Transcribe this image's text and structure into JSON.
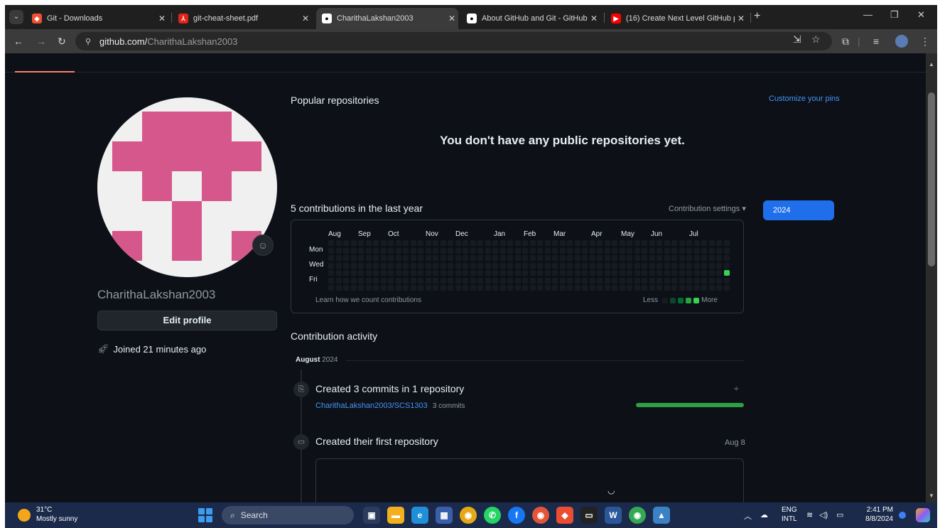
{
  "browser": {
    "tabs": [
      {
        "title": "Git - Downloads",
        "favicon": "git-icon",
        "color": "#f05133"
      },
      {
        "title": "git-cheat-sheet.pdf",
        "favicon": "pdf-icon",
        "color": "#e2231a"
      },
      {
        "title": "CharithaLakshan2003",
        "favicon": "github-icon",
        "color": "#ffffff"
      },
      {
        "title": "About GitHub and Git - GitHub",
        "favicon": "github-icon",
        "color": "#ffffff"
      },
      {
        "title": "(16) Create Next Level GitHub p",
        "favicon": "youtube-icon",
        "color": "#ff0000"
      }
    ],
    "active_tab_index": 2,
    "url_host": "github.com/",
    "url_path": "CharithaLakshan2003"
  },
  "profile": {
    "username": "CharithaLakshan2003",
    "edit_label": "Edit profile",
    "joined": "Joined 21 minutes ago",
    "avatar_color": "#d6578b"
  },
  "popular": {
    "title": "Popular repositories",
    "customize": "Customize your pins",
    "empty_message": "You don't have any public repositories yet."
  },
  "contributions": {
    "title": "5 contributions in the last year",
    "settings_label": "Contribution settings",
    "year": "2024",
    "months": [
      "Aug",
      "Sep",
      "Oct",
      "Nov",
      "Dec",
      "Jan",
      "Feb",
      "Mar",
      "Apr",
      "May",
      "Jun",
      "Jul"
    ],
    "day_labels": [
      "Mon",
      "Wed",
      "Fri"
    ],
    "learn": "Learn how we count contributions",
    "legend_less": "Less",
    "legend_more": "More",
    "active_cell": {
      "week": 53,
      "day": 4
    }
  },
  "activity": {
    "title": "Contribution activity",
    "month": "August",
    "year": "2024",
    "events": [
      {
        "title": "Created 3 commits in 1 repository",
        "repo": "CharithaLakshan2003/SCS1303",
        "commits": "3 commits",
        "progress": 1.0
      },
      {
        "title": "Created their first repository",
        "date": "Aug 8"
      }
    ]
  },
  "taskbar": {
    "temp": "31°C",
    "weather": "Mostly sunny",
    "search": "Search",
    "lang1": "ENG",
    "lang2": "INTL",
    "time": "2:41 PM",
    "date": "8/8/2024"
  }
}
